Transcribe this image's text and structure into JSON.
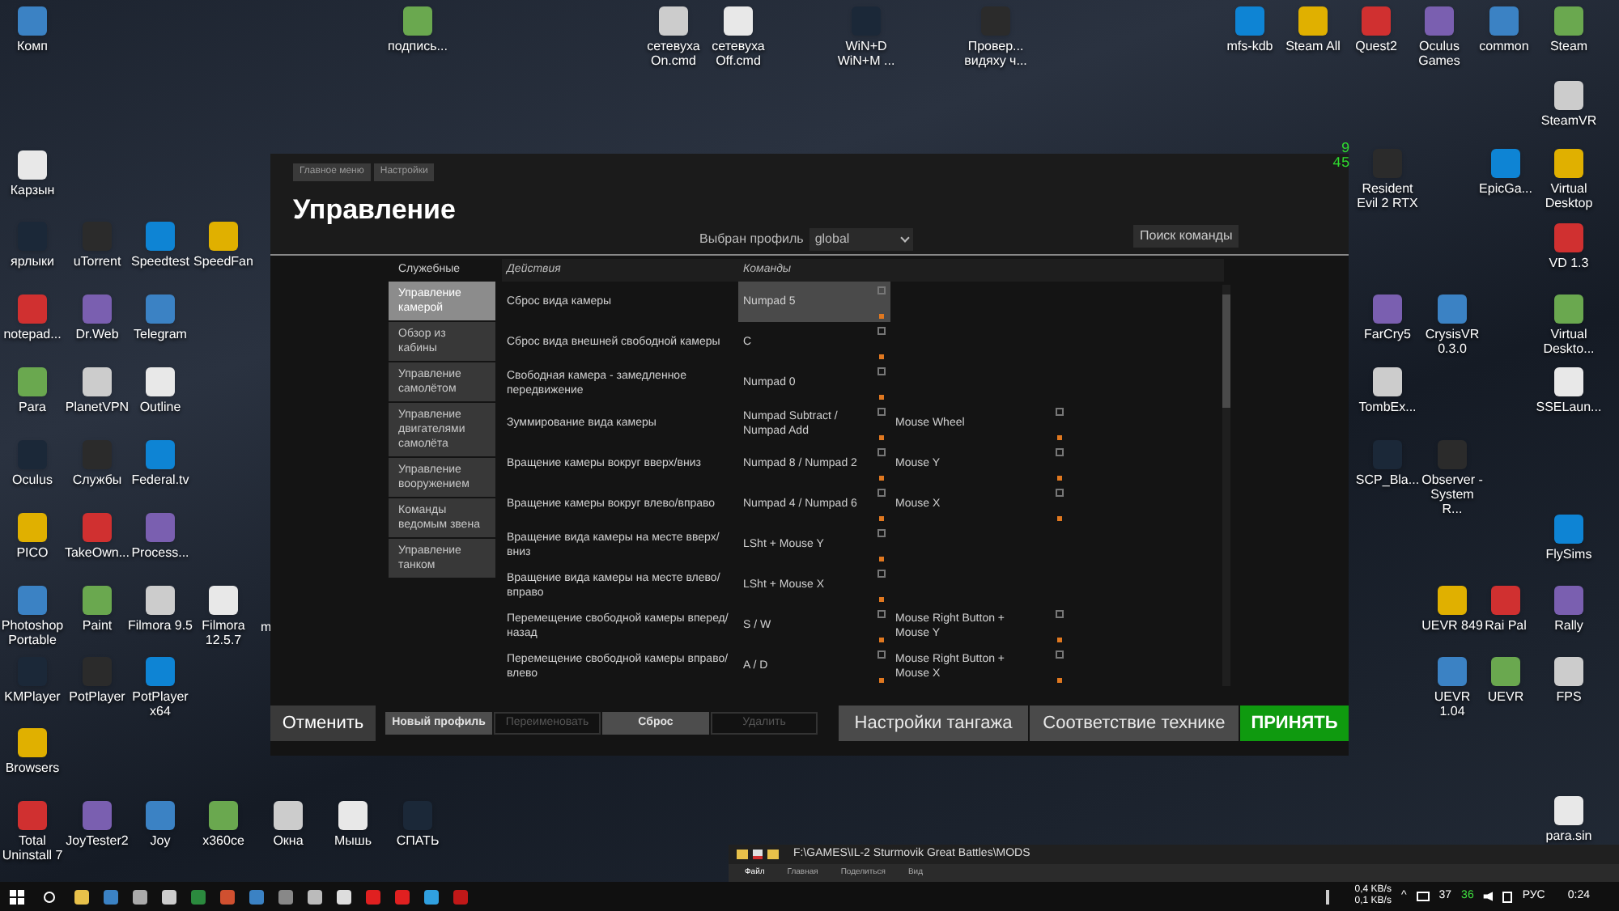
{
  "desktop_icons": [
    {
      "label": "Комп"
    },
    {
      "label": "подпись..."
    },
    {
      "label": "сетевуха On.cmd"
    },
    {
      "label": "сетевуха Off.cmd"
    },
    {
      "label": "WiN+D WiN+M ..."
    },
    {
      "label": "Провер... видяху ч..."
    },
    {
      "label": "mfs-kdb"
    },
    {
      "label": "Steam All"
    },
    {
      "label": "Quest2"
    },
    {
      "label": "Oculus Games"
    },
    {
      "label": "common"
    },
    {
      "label": "Steam"
    },
    {
      "label": "SteamVR"
    },
    {
      "label": "Карзын"
    },
    {
      "label": "ярлыки"
    },
    {
      "label": "uTorrent"
    },
    {
      "label": "Speedtest"
    },
    {
      "label": "SpeedFan"
    },
    {
      "label": "notepad..."
    },
    {
      "label": "Dr.Web"
    },
    {
      "label": "Telegram"
    },
    {
      "label": "Para"
    },
    {
      "label": "PlanetVPN"
    },
    {
      "label": "Outline"
    },
    {
      "label": "Oculus"
    },
    {
      "label": "Службы"
    },
    {
      "label": "Federal.tv"
    },
    {
      "label": "PICO"
    },
    {
      "label": "TakeOwn..."
    },
    {
      "label": "Process..."
    },
    {
      "label": "Photoshop Portable"
    },
    {
      "label": "Paint"
    },
    {
      "label": "Filmora 9.5"
    },
    {
      "label": "Filmora 12.5.7"
    },
    {
      "label": "KMPlayer"
    },
    {
      "label": "PotPlayer"
    },
    {
      "label": "PotPlayer x64"
    },
    {
      "label": "Browsers"
    },
    {
      "label": "Total Uninstall 7"
    },
    {
      "label": "JoyTester2"
    },
    {
      "label": "Joy"
    },
    {
      "label": "x360ce"
    },
    {
      "label": "Окна"
    },
    {
      "label": "Мышь"
    },
    {
      "label": "СПАТЬ"
    },
    {
      "label": "Resident Evil 2 RTX"
    },
    {
      "label": "EpicGa..."
    },
    {
      "label": "Virtual Desktop"
    },
    {
      "label": "VD 1.3"
    },
    {
      "label": "FarCry5"
    },
    {
      "label": "CrysisVR 0.3.0"
    },
    {
      "label": "Virtual Deskto..."
    },
    {
      "label": "TombEx..."
    },
    {
      "label": "SSELaun..."
    },
    {
      "label": "SCP_Bla..."
    },
    {
      "label": "Observer - System R..."
    },
    {
      "label": "FlySims"
    },
    {
      "label": "UEVR 849"
    },
    {
      "label": "Rai Pal"
    },
    {
      "label": "Rally"
    },
    {
      "label": "UEVR 1.04"
    },
    {
      "label": "UEVR"
    },
    {
      "label": "FPS"
    },
    {
      "label": "para.sin"
    }
  ],
  "cut_label": "m",
  "fps_counter": [
    "9",
    "45"
  ],
  "dialog": {
    "breadcrumb": [
      "Главное меню",
      "Настройки"
    ],
    "title": "Управление",
    "profile_label": "Выбран профиль",
    "profile_value": "global",
    "search_button": "Поиск команды",
    "categories_header": "Служебные",
    "categories": [
      {
        "label": "Управление камерой",
        "selected": true
      },
      {
        "label": "Обзор из кабины",
        "selected": false
      },
      {
        "label": "Управление самолётом",
        "selected": false
      },
      {
        "label": "Управление двигателями самолёта",
        "selected": false
      },
      {
        "label": "Управление вооружением",
        "selected": false
      },
      {
        "label": "Команды ведомым звена",
        "selected": false
      },
      {
        "label": "Управление танком",
        "selected": false
      }
    ],
    "columns": [
      "Действия",
      "Команды"
    ],
    "rows": [
      {
        "action": "Сброс вида камеры",
        "command_1": "Numpad 5",
        "command_2": "",
        "selected": true
      },
      {
        "action": "Сброс вида внешней свободной камеры",
        "command_1": "C",
        "command_2": "",
        "selected": false
      },
      {
        "action": "Свободная камера - замедленное передвижение",
        "command_1": "Numpad 0",
        "command_2": "",
        "selected": false
      },
      {
        "action": "Зуммирование вида камеры",
        "command_1": "Numpad Subtract / Numpad Add",
        "command_2": "Mouse Wheel",
        "selected": false
      },
      {
        "action": "Вращение камеры вокруг вверх/вниз",
        "command_1": "Numpad 8 / Numpad 2",
        "command_2": "Mouse Y",
        "selected": false
      },
      {
        "action": "Вращение камеры вокруг влево/вправо",
        "command_1": "Numpad 4 / Numpad 6",
        "command_2": "Mouse X",
        "selected": false
      },
      {
        "action": "Вращение вида камеры на месте вверх/вниз",
        "command_1": "LSht + Mouse Y",
        "command_2": "",
        "selected": false
      },
      {
        "action": "Вращение вида камеры на месте влево/вправо",
        "command_1": "LSht + Mouse X",
        "command_2": "",
        "selected": false
      },
      {
        "action": "Перемещение свободной камеры вперед/назад",
        "command_1": "S / W",
        "command_2": "Mouse Right Button + Mouse Y",
        "selected": false
      },
      {
        "action": "Перемещение свободной камеры вправо/влево",
        "command_1": "A / D",
        "command_2": "Mouse Right Button + Mouse X",
        "selected": false
      }
    ],
    "cancel_button": "Отменить",
    "profile_buttons": [
      {
        "label": "Новый профиль",
        "disabled": false
      },
      {
        "label": "Переименовать",
        "disabled": true
      },
      {
        "label": "Сброс",
        "disabled": false
      },
      {
        "label": "Удалить",
        "disabled": true
      }
    ],
    "action_buttons": [
      {
        "label": "Настройки тангажа",
        "kind": "normal"
      },
      {
        "label": "Соответствие технике",
        "kind": "normal"
      },
      {
        "label": "ПРИНЯТЬ",
        "kind": "accept"
      }
    ]
  },
  "explorer": {
    "path": "F:\\GAMES\\IL-2 Sturmovik Great Battles\\MODS",
    "tabs": [
      "Файл",
      "Главная",
      "Поделиться",
      "Вид"
    ]
  },
  "taskbar": {
    "net_up": "0,4 KB/s",
    "net_down": "0,1 KB/s",
    "tray_arrow": "^",
    "cpu_temp": "37",
    "gpu_temp": "36",
    "language": "РУС",
    "time": "0:24"
  }
}
